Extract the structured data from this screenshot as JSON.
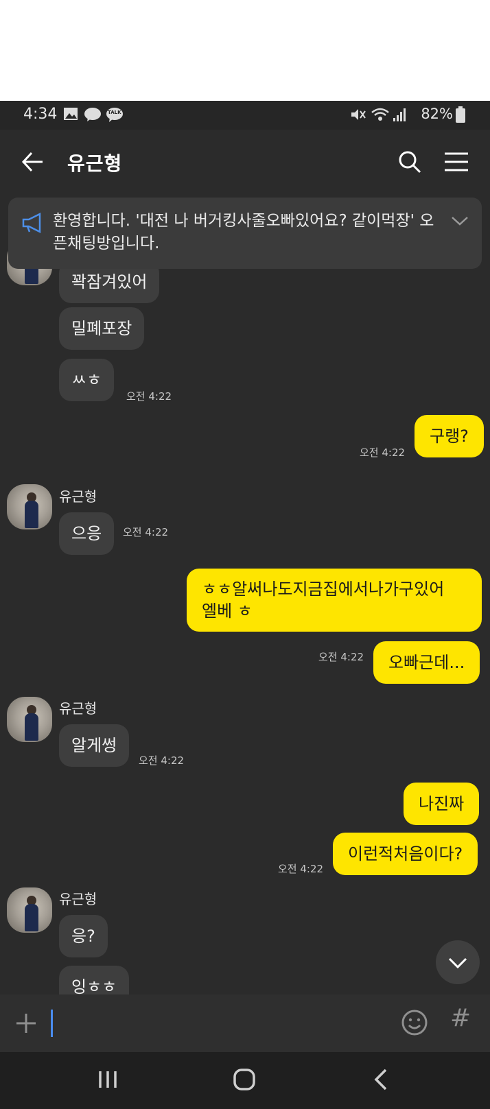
{
  "status_bar": {
    "time": "4:34",
    "battery": "82%",
    "talk_badge": "TALK"
  },
  "header": {
    "title": "유근형"
  },
  "notice": {
    "text": "환영합니다. '대전 나 버거킹사줄오빠있어요? 같이먹장' 오픈채팅방입니다."
  },
  "messages": [
    {
      "side": "in",
      "text": "꽉잠겨있어"
    },
    {
      "side": "in",
      "text": "밀폐포장"
    },
    {
      "side": "in",
      "text": "ㅆㅎ",
      "time": "오전 4:22"
    },
    {
      "side": "out",
      "text": "구랭?",
      "time": "오전 4:22"
    },
    {
      "side": "in",
      "sender": "유근형",
      "text": "으응",
      "time": "오전 4:22"
    },
    {
      "side": "out",
      "lines": [
        "ㅎㅎ알써나도지금집에서나가구있어",
        "엘베 ㅎ"
      ]
    },
    {
      "side": "out",
      "text": "오빠근데...",
      "time": "오전 4:22"
    },
    {
      "side": "in",
      "sender": "유근형",
      "text": "알게썽",
      "time": "오전 4:22"
    },
    {
      "side": "out",
      "text": "나진짜"
    },
    {
      "side": "out",
      "text": "이런적처음이다?",
      "time": "오전 4:22"
    },
    {
      "side": "in",
      "sender": "유근형",
      "text": "응?"
    },
    {
      "side": "in",
      "text": "잉ㅎㅎ"
    }
  ],
  "input": {
    "placeholder": "",
    "hash_symbol": "#"
  },
  "colors": {
    "background": "#2b2b2b",
    "incoming_bubble": "#3e3e3e",
    "outgoing_bubble": "#fee500",
    "cursor": "#4a8df0"
  },
  "icons": [
    "back-arrow-icon",
    "search-icon",
    "menu-icon",
    "megaphone-icon",
    "chevron-down-icon",
    "plus-icon",
    "emoji-icon",
    "hash-icon",
    "recents-icon",
    "home-icon",
    "back-nav-icon"
  ]
}
